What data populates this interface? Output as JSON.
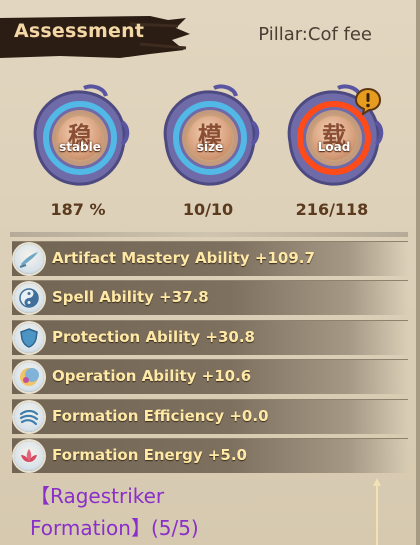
{
  "header": {
    "title": "Assessment",
    "pillar": "Pillar:Cof fee"
  },
  "stats": [
    {
      "glyph": "稳",
      "tag": "stable",
      "value": "187 %",
      "ring_color": "#52b8e6",
      "alert": false
    },
    {
      "glyph": "模",
      "tag": "size",
      "value": "10/10",
      "ring_color": "#52b8e6",
      "alert": false
    },
    {
      "glyph": "载",
      "tag": "Load",
      "value": "216/118",
      "ring_color": "#ff4a1a",
      "alert": true
    }
  ],
  "abilities": [
    {
      "label": "Artifact Mastery Ability +109.7",
      "icon": "brush-icon"
    },
    {
      "label": "Spell Ability +37.8",
      "icon": "yin-yang-icon"
    },
    {
      "label": "Protection Ability +30.8",
      "icon": "shield-icon"
    },
    {
      "label": "Operation Ability +10.6",
      "icon": "crescent-icon"
    },
    {
      "label": "Formation Efficiency +0.0",
      "icon": "swirl-icon"
    },
    {
      "label": "Formation Energy +5.0",
      "icon": "lotus-icon"
    }
  ],
  "formation": {
    "line1": "【Ragestriker",
    "line2": "Formation】(5/5)"
  },
  "colors": {
    "ability_text": "#ffe9a6",
    "formation_text": "#8a2fc9",
    "stat_value": "#5b3a1e"
  }
}
